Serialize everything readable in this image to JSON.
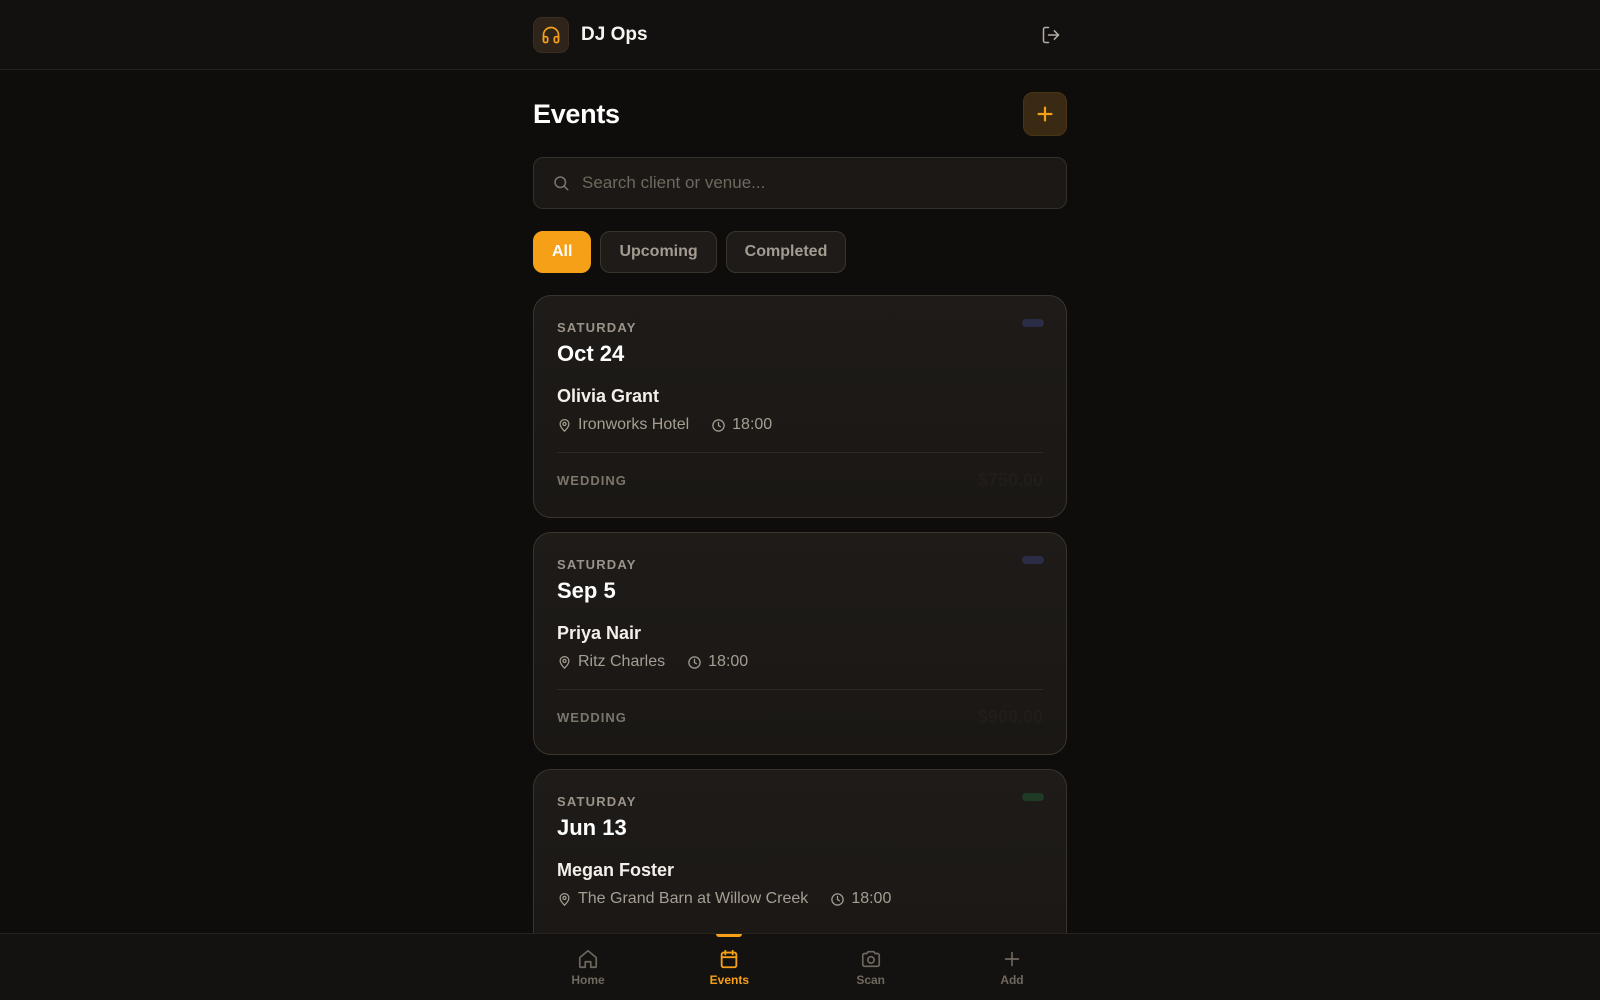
{
  "app": {
    "title": "DJ Ops"
  },
  "header": {
    "title": "Events"
  },
  "search": {
    "placeholder": "Search client or venue..."
  },
  "filters": [
    {
      "label": "All",
      "active": true
    },
    {
      "label": "Upcoming",
      "active": false
    },
    {
      "label": "Completed",
      "active": false
    }
  ],
  "events": [
    {
      "weekday": "SATURDAY",
      "date": "Oct 24",
      "client": "Olivia Grant",
      "venue": "Ironworks Hotel",
      "time": "18:00",
      "type": "WEDDING",
      "price": "$750.00",
      "status_color": "#2a2d45"
    },
    {
      "weekday": "SATURDAY",
      "date": "Sep 5",
      "client": "Priya Nair",
      "venue": "Ritz Charles",
      "time": "18:00",
      "type": "WEDDING",
      "price": "$900.00",
      "status_color": "#2a2d45"
    },
    {
      "weekday": "SATURDAY",
      "date": "Jun 13",
      "client": "Megan Foster",
      "venue": "The Grand Barn at Willow Creek",
      "time": "18:00",
      "type": "",
      "price": "",
      "status_color": "#1f3a25"
    }
  ],
  "nav": [
    {
      "label": "Home",
      "icon": "home-icon",
      "active": false
    },
    {
      "label": "Events",
      "icon": "calendar-icon",
      "active": true
    },
    {
      "label": "Scan",
      "icon": "camera-icon",
      "active": false
    },
    {
      "label": "Add",
      "icon": "plus-icon",
      "active": false
    }
  ],
  "colors": {
    "accent": "#f5a017",
    "background": "#0f0d0b",
    "card": "#1e1b18"
  }
}
